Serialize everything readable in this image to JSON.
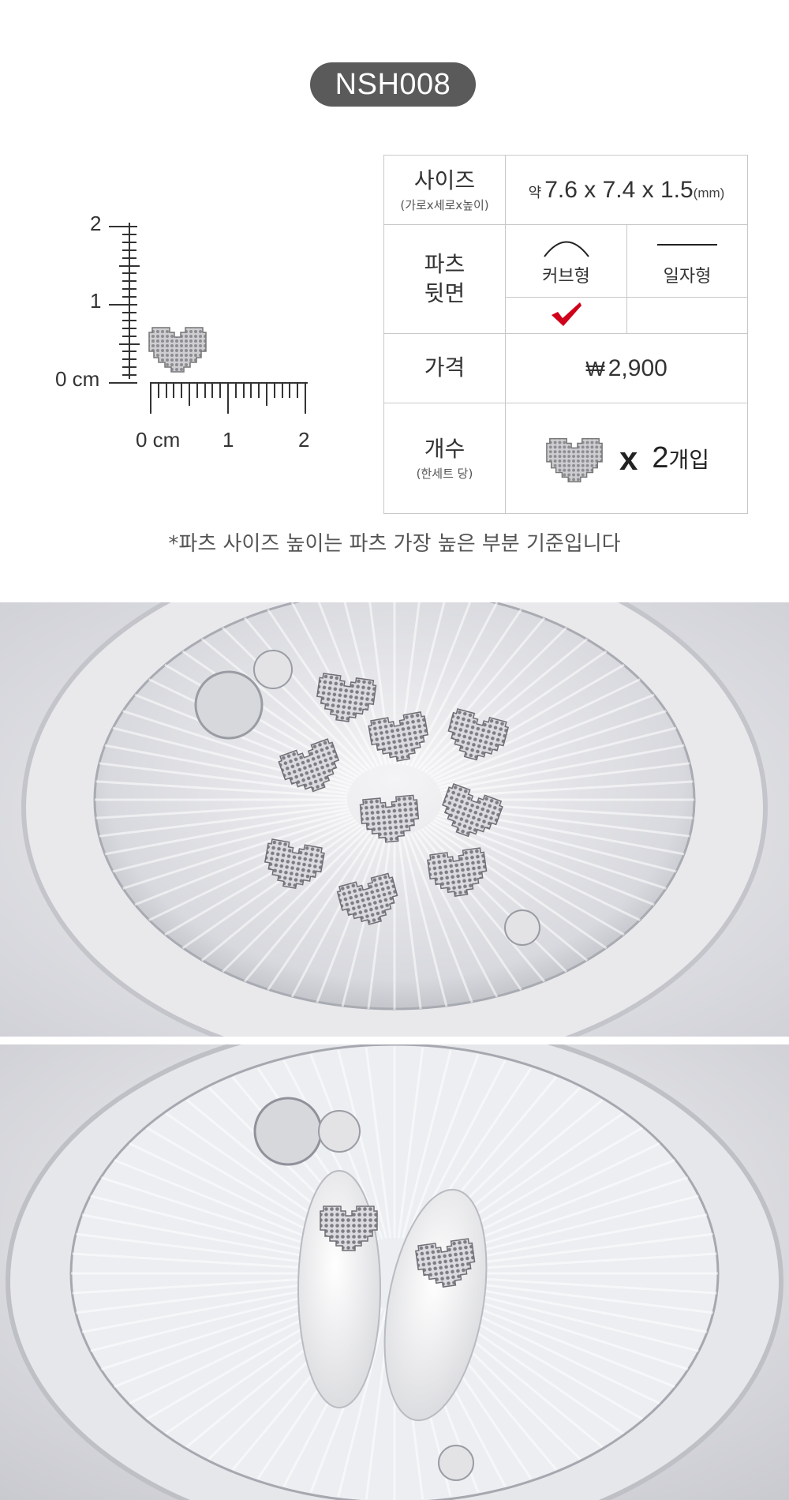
{
  "product_code": "NSH008",
  "ruler": {
    "vertical_labels": [
      "2",
      "1",
      "0 cm"
    ],
    "horizontal_labels": [
      "0 cm",
      "1",
      "2"
    ]
  },
  "spec": {
    "size_header": "사이즈",
    "size_sub": "(가로x세로x높이)",
    "size_prefix": "약",
    "size_value": "7.6 x 7.4 x 1.5",
    "size_unit": "(mm)",
    "back_header_line1": "파츠",
    "back_header_line2": "뒷면",
    "back_option_curved": "커브형",
    "back_option_flat": "일자형",
    "back_selected": "curved",
    "price_header": "가격",
    "price_symbol": "₩",
    "price_value": "2,900",
    "count_header": "개수",
    "count_sub": "(한세트 당)",
    "count_x": "x",
    "count_number": "2",
    "count_unit": "개입"
  },
  "note": "*파츠 사이즈 높이는 파츠 가장 높은 부분 기준입니다",
  "colors": {
    "badge": "#5a5a5a",
    "check": "#d0021b",
    "table_border": "#c8c8c8"
  }
}
